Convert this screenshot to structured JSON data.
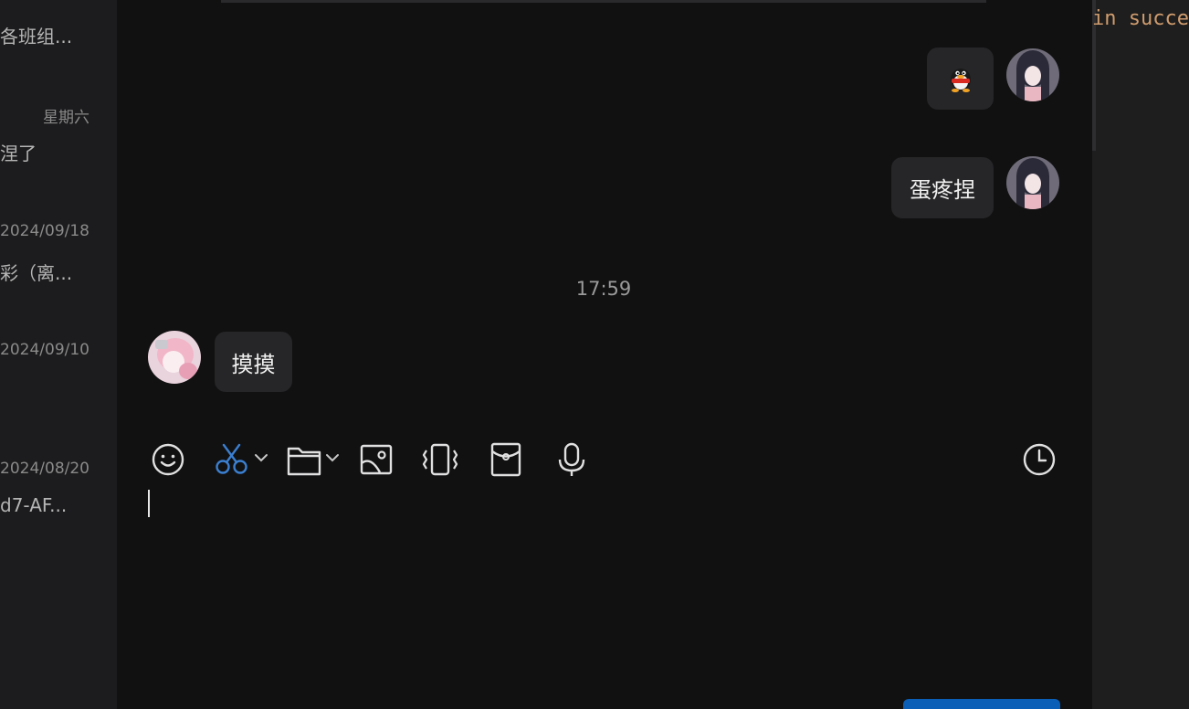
{
  "sidebar": {
    "items": [
      {
        "time": "",
        "message": "各班组..."
      },
      {
        "time": "星期六",
        "message": "涅了"
      },
      {
        "time": "2024/09/18",
        "message": "彩（离..."
      },
      {
        "time": "2024/09/10",
        "message": ""
      },
      {
        "time": "2024/08/20",
        "message": "d7-AF..."
      }
    ]
  },
  "chat": {
    "messages": [
      {
        "side": "right",
        "type": "sticker",
        "sticker_icon": "qq-penguin-icon"
      },
      {
        "side": "right",
        "type": "text",
        "text": "蛋疼捏"
      },
      {
        "side": "left",
        "type": "text",
        "text": "摸摸"
      }
    ],
    "timestamp": "17:59"
  },
  "toolbar": {
    "items": [
      {
        "icon": "emoji-icon"
      },
      {
        "icon": "scissors-icon",
        "color": "#3b7fd0",
        "has_dropdown": true
      },
      {
        "icon": "folder-icon",
        "has_dropdown": true
      },
      {
        "icon": "image-icon"
      },
      {
        "icon": "shake-icon"
      },
      {
        "icon": "red-packet-icon"
      },
      {
        "icon": "microphone-icon"
      },
      {
        "icon": "history-clock-icon"
      }
    ]
  },
  "editor": {
    "code_text": "in succe"
  },
  "colors": {
    "accent": "#0b5fb6",
    "code": "#cf9c6e",
    "background": "#111112"
  }
}
